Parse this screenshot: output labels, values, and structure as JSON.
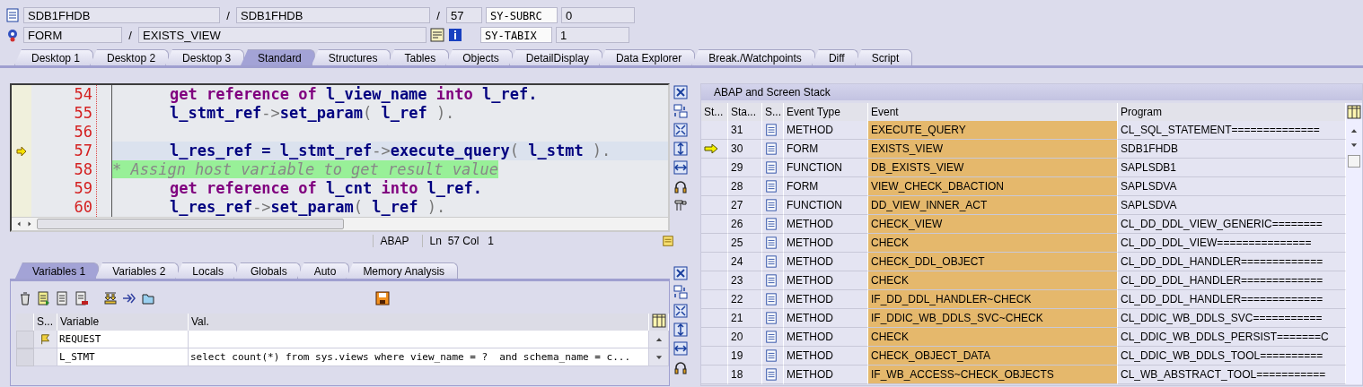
{
  "header": {
    "program": "SDB1FHDB",
    "include": "SDB1FHDB",
    "line": "57",
    "event_type": "FORM",
    "event": "EXISTS_VIEW",
    "separators": [
      "/",
      "/",
      "/"
    ],
    "sysfields": [
      {
        "name": "SY-SUBRC",
        "value": "0"
      },
      {
        "name": "SY-TABIX",
        "value": "1"
      }
    ]
  },
  "tabs": [
    {
      "label": "Desktop 1",
      "selected": false
    },
    {
      "label": "Desktop 2",
      "selected": false
    },
    {
      "label": "Desktop 3",
      "selected": false
    },
    {
      "label": "Standard",
      "selected": true
    },
    {
      "label": "Structures",
      "selected": false
    },
    {
      "label": "Tables",
      "selected": false
    },
    {
      "label": "Objects",
      "selected": false
    },
    {
      "label": "DetailDisplay",
      "selected": false
    },
    {
      "label": "Data Explorer",
      "selected": false
    },
    {
      "label": "Break./Watchpoints",
      "selected": false
    },
    {
      "label": "Diff",
      "selected": false
    },
    {
      "label": "Script",
      "selected": false
    }
  ],
  "editor": {
    "lines": [
      {
        "number": "54",
        "kind": "code",
        "current": false,
        "tokens": [
          {
            "text": "get reference of",
            "kind": "kw"
          },
          {
            "text": " l_view_name ",
            "kind": "id"
          },
          {
            "text": "into",
            "kind": "kw"
          },
          {
            "text": " l_ref.",
            "kind": "id"
          }
        ]
      },
      {
        "number": "55",
        "kind": "code",
        "current": false,
        "tokens": [
          {
            "text": "l_stmt_ref",
            "kind": "id"
          },
          {
            "text": "->",
            "kind": "op"
          },
          {
            "text": "set_param",
            "kind": "id"
          },
          {
            "text": "(",
            "kind": "op"
          },
          {
            "text": " l_ref ",
            "kind": "id"
          },
          {
            "text": ").",
            "kind": "op"
          }
        ]
      },
      {
        "number": "56",
        "kind": "code",
        "current": false
      },
      {
        "number": "57",
        "kind": "code",
        "current": true,
        "tokens": [
          {
            "text": "l_res_ref = l_stmt_ref",
            "kind": "id"
          },
          {
            "text": "->",
            "kind": "op"
          },
          {
            "text": "execute_query",
            "kind": "id"
          },
          {
            "text": "(",
            "kind": "op"
          },
          {
            "text": " l_stmt ",
            "kind": "id"
          },
          {
            "text": ").",
            "kind": "op"
          }
        ]
      },
      {
        "number": "58",
        "kind": "comment",
        "current": false,
        "tokens": [
          {
            "text": "* Assign host variable to get result value",
            "kind": "comment"
          }
        ]
      },
      {
        "number": "59",
        "kind": "code",
        "current": false,
        "tokens": [
          {
            "text": "get reference of",
            "kind": "kw"
          },
          {
            "text": " l_cnt ",
            "kind": "id"
          },
          {
            "text": "into",
            "kind": "kw"
          },
          {
            "text": " l_ref.",
            "kind": "id"
          }
        ]
      },
      {
        "number": "60",
        "kind": "code",
        "current": false,
        "tokens": [
          {
            "text": "l_res_ref",
            "kind": "id"
          },
          {
            "text": "->",
            "kind": "op"
          },
          {
            "text": "set_param",
            "kind": "id"
          },
          {
            "text": "(",
            "kind": "op"
          },
          {
            "text": " l_ref ",
            "kind": "id"
          },
          {
            "text": ").",
            "kind": "op"
          }
        ]
      }
    ],
    "status": {
      "language": "ABAP",
      "position": "Ln  57 Col   1"
    }
  },
  "variables": {
    "tabs": [
      {
        "label": "Variables 1",
        "selected": true
      },
      {
        "label": "Variables 2",
        "selected": false
      },
      {
        "label": "Locals",
        "selected": false
      },
      {
        "label": "Globals",
        "selected": false
      },
      {
        "label": "Auto",
        "selected": false
      },
      {
        "label": "Memory Analysis",
        "selected": false
      }
    ],
    "columns": [
      "S...",
      "Variable",
      "Val."
    ],
    "rows": [
      {
        "flagged": true,
        "variable": "REQUEST"
      },
      {
        "flagged": false,
        "variable": "L_STMT",
        "value": "select count(*) from sys.views where view_name = ?  and schema_name = c..."
      }
    ]
  },
  "stack": {
    "title": "ABAP and Screen Stack",
    "columns": [
      "St...",
      "Sta...",
      "S...",
      "Event Type",
      "Event",
      "Program"
    ],
    "rows": [
      {
        "current": false,
        "level": "31",
        "type": "METHOD",
        "event": "EXECUTE_QUERY",
        "program": "CL_SQL_STATEMENT=============="
      },
      {
        "current": true,
        "level": "30",
        "type": "FORM",
        "event": "EXISTS_VIEW",
        "program": "SDB1FHDB"
      },
      {
        "current": false,
        "level": "29",
        "type": "FUNCTION",
        "event": "DB_EXISTS_VIEW",
        "program": "SAPLSDB1"
      },
      {
        "current": false,
        "level": "28",
        "type": "FORM",
        "event": "VIEW_CHECK_DBACTION",
        "program": "SAPLSDVA"
      },
      {
        "current": false,
        "level": "27",
        "type": "FUNCTION",
        "event": "DD_VIEW_INNER_ACT",
        "program": "SAPLSDVA"
      },
      {
        "current": false,
        "level": "26",
        "type": "METHOD",
        "event": "CHECK_VIEW",
        "program": "CL_DD_DDL_VIEW_GENERIC========"
      },
      {
        "current": false,
        "level": "25",
        "type": "METHOD",
        "event": "CHECK",
        "program": "CL_DD_DDL_VIEW==============="
      },
      {
        "current": false,
        "level": "24",
        "type": "METHOD",
        "event": "CHECK_DDL_OBJECT",
        "program": "CL_DD_DDL_HANDLER============="
      },
      {
        "current": false,
        "level": "23",
        "type": "METHOD",
        "event": "CHECK",
        "program": "CL_DD_DDL_HANDLER============="
      },
      {
        "current": false,
        "level": "22",
        "type": "METHOD",
        "event": "IF_DD_DDL_HANDLER~CHECK",
        "program": "CL_DD_DDL_HANDLER============="
      },
      {
        "current": false,
        "level": "21",
        "type": "METHOD",
        "event": "IF_DDIC_WB_DDLS_SVC~CHECK",
        "program": "CL_DDIC_WB_DDLS_SVC==========="
      },
      {
        "current": false,
        "level": "20",
        "type": "METHOD",
        "event": "CHECK",
        "program": "CL_DDIC_WB_DDLS_PERSIST=======C"
      },
      {
        "current": false,
        "level": "19",
        "type": "METHOD",
        "event": "CHECK_OBJECT_DATA",
        "program": "CL_DDIC_WB_DDLS_TOOL=========="
      },
      {
        "current": false,
        "level": "18",
        "type": "METHOD",
        "event": "IF_WB_ACCESS~CHECK_OBJECTS",
        "program": "CL_WB_ABSTRACT_TOOL==========="
      }
    ]
  }
}
